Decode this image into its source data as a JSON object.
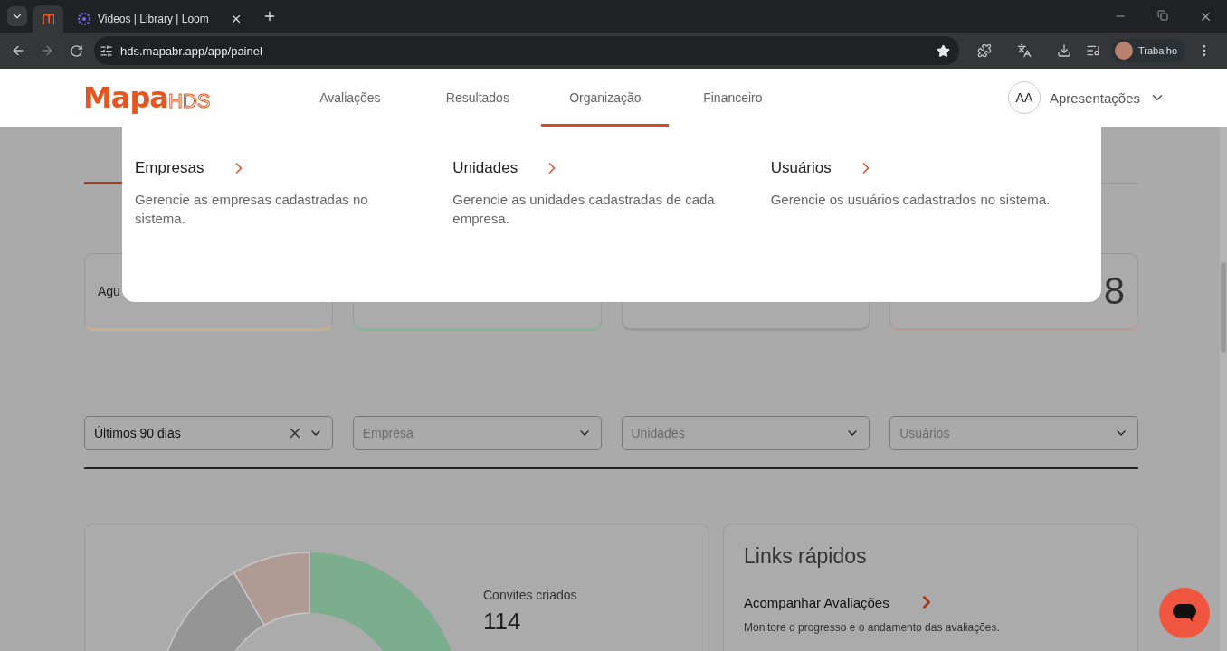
{
  "browser": {
    "tabs": [
      {
        "selected": true
      },
      {
        "title": "Videos | Library | Loom",
        "selected": false
      }
    ],
    "url": "hds.mapabr.app/app/painel",
    "profile": "Trabalho"
  },
  "header": {
    "logo": {
      "mark": "Mapa",
      "suffix": "HDS"
    },
    "nav": [
      {
        "label": "Avaliações",
        "selected": false
      },
      {
        "label": "Resultados",
        "selected": false
      },
      {
        "label": "Organização",
        "selected": true
      },
      {
        "label": "Financeiro",
        "selected": false
      }
    ],
    "user": {
      "initials": "AA",
      "label": "Apresentações"
    }
  },
  "menu": [
    {
      "title": "Empresas",
      "description": "Gerencie as empresas cadastradas no sistema."
    },
    {
      "title": "Unidades",
      "description": "Gerencie as unidades cadastradas de cada empresa."
    },
    {
      "title": "Usuários",
      "description": "Gerencie os usuários cadastrados no sistema."
    }
  ],
  "stats": [
    {
      "label": "Agu",
      "color": "#c9ad8e"
    },
    {
      "color": "#82b894"
    },
    {
      "color": "#9a9a9a"
    },
    {
      "value": "8",
      "color": "#b89a94"
    }
  ],
  "filters": [
    {
      "value": "Últimos 90 dias",
      "clearable": true
    },
    {
      "placeholder": "Empresa"
    },
    {
      "placeholder": "Unidades"
    },
    {
      "placeholder": "Usuários"
    }
  ],
  "summary": {
    "label": "Convites criados",
    "value": "114"
  },
  "quick_links": {
    "title": "Links rápidos",
    "items": [
      {
        "title": "Acompanhar Avaliações",
        "description": "Monitore o progresso e o andamento das avaliações."
      }
    ]
  }
}
